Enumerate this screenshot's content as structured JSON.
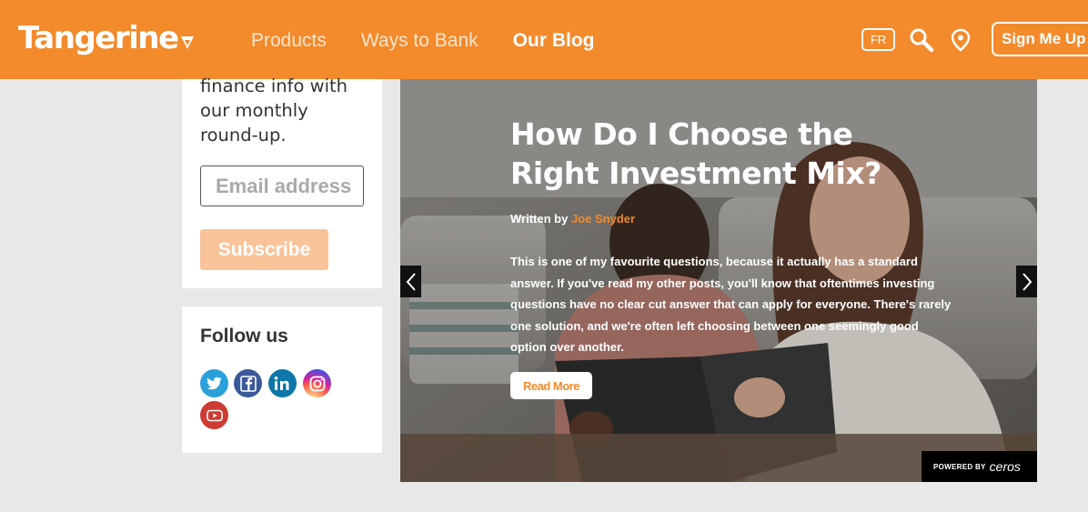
{
  "header": {
    "logo_text": "Tangerine",
    "nav": [
      "Products",
      "Ways to Bank",
      "Our Blog"
    ],
    "active_nav": "Our Blog",
    "lang_toggle": "FR",
    "search_icon": "search-icon",
    "location_icon": "map-pin-icon",
    "sign_me_up": "Sign Me Up"
  },
  "newsletter": {
    "blurb": "finance info with our monthly round-up.",
    "email_placeholder": "Email address",
    "subscribe_label": "Subscribe"
  },
  "follow": {
    "heading": "Follow us",
    "icons": [
      {
        "name": "twitter-icon",
        "color": "#1da1f2"
      },
      {
        "name": "facebook-icon",
        "color": "#3b5998"
      },
      {
        "name": "linkedin-icon",
        "color": "#0e76a8"
      },
      {
        "name": "instagram-icon",
        "color": "#c13584"
      },
      {
        "name": "youtube-icon",
        "color": "#cd201f"
      }
    ]
  },
  "carousel": {
    "title": "How Do I Choose the Right Investment Mix?",
    "written_by": "Written by",
    "author": "Joe Snyder",
    "excerpt": "This is one of my favourite questions, because it actually has a standard answer. If you've read my other posts, you'll know that oftentimes investing questions have no clear cut answer that can apply for everyone. There's rarely one solution, and we're often left choosing between one seemingly good option over another.",
    "read_more": "Read More",
    "prev_icon": "chevron-left-icon",
    "next_icon": "chevron-right-icon",
    "powered_by": "POWERED BY",
    "powered_brand": "ceros"
  },
  "colors": {
    "brand_orange": "#f38a2b",
    "subscribe_disabled": "#f9c49a",
    "background": "#e8e8e8"
  }
}
